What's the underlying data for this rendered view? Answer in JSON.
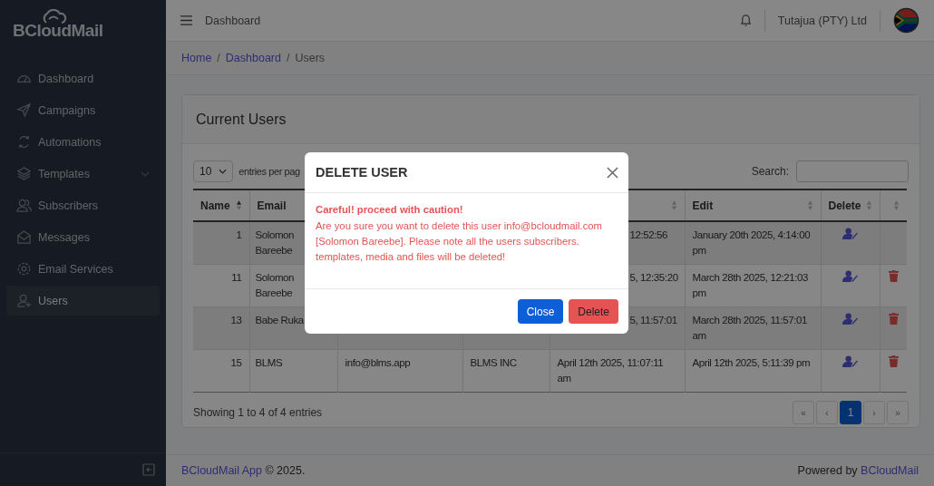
{
  "sidebar": {
    "logo": "BCloudMail",
    "items": [
      {
        "label": "Dashboard",
        "selected": false
      },
      {
        "label": "Campaigns",
        "selected": false
      },
      {
        "label": "Automations",
        "selected": false
      },
      {
        "label": "Templates",
        "selected": false,
        "expanded": false
      },
      {
        "label": "Subscribers",
        "selected": false
      },
      {
        "label": "Messages",
        "selected": false
      },
      {
        "label": "Email Services",
        "selected": false
      },
      {
        "label": "Users",
        "selected": true
      }
    ]
  },
  "header": {
    "title": "Dashboard",
    "company": "Tutajua (PTY) Ltd"
  },
  "breadcrumb": {
    "separator": "/",
    "items": [
      {
        "label": "Home",
        "current": false
      },
      {
        "label": "Dashboard",
        "current": false
      },
      {
        "label": "Users",
        "current": true
      }
    ]
  },
  "card": {
    "title": "Current Users",
    "entries": {
      "value": "10",
      "label": "entries per pag"
    },
    "search": {
      "label": "Search:"
    },
    "table": {
      "columns": [
        {
          "label": "Name",
          "sorted": true
        },
        {
          "label": "Email"
        },
        null,
        null,
        {
          "sorted": false
        },
        {
          "label": "Edit",
          "sorted": false
        },
        {
          "label": "Delete",
          "sorted": false
        },
        {
          "sorted": false
        }
      ],
      "rows": [
        {
          "cells": [
            {
              "text": "1",
              "kind": "full"
            },
            {
              "text": "Solomon Bareebe",
              "kind": "full"
            },
            null,
            null,
            {
              "text": "12:52:56",
              "kind": "partial"
            },
            {
              "text": "January 20th 2025, 4:14:00 pm",
              "kind": "full"
            }
          ],
          "deletable": false
        },
        {
          "cells": [
            {
              "text": "11",
              "kind": "full"
            },
            {
              "text": "Solomon Bareebe",
              "kind": "full"
            },
            null,
            null,
            {
              "text": "5, 12:35:20",
              "kind": "partial"
            },
            {
              "text": "March 28th 2025, 12:21:03 pm",
              "kind": "full"
            }
          ],
          "deletable": true
        },
        {
          "cells": [
            {
              "text": "13",
              "kind": "full"
            },
            {
              "text": "Babe Ruka",
              "kind": "full"
            },
            null,
            null,
            {
              "text": "5, 11:57:01",
              "kind": "partial"
            },
            {
              "text": "March 28th 2025, 11:57:01 am",
              "kind": "full"
            }
          ],
          "deletable": true
        },
        {
          "cells": [
            {
              "text": "15",
              "kind": "full"
            },
            {
              "text": "BLMS",
              "kind": "full"
            },
            {
              "text": "info@blms.app",
              "kind": "full"
            },
            {
              "text": "BLMS INC",
              "kind": "full"
            },
            {
              "text": "April 12th 2025, 11:07:11 am",
              "kind": "full"
            },
            {
              "text": "April 12th 2025, 5:11:39 pm",
              "kind": "full"
            }
          ],
          "deletable": true
        }
      ]
    },
    "info": "Showing 1 to 4 of 4 entries",
    "pagination": [
      {
        "label": "«",
        "selected": false
      },
      {
        "label": "‹",
        "selected": false
      },
      {
        "label": "1",
        "selected": true
      },
      {
        "label": "›",
        "selected": false
      },
      {
        "label": "»",
        "selected": false
      }
    ]
  },
  "footer": {
    "app_link": "BCloudMail App",
    "copyright": "© 2025.",
    "powered_by": "Powered by",
    "powered_link": "BCloudMail"
  },
  "modal": {
    "title": "DELETE USER",
    "warning": "Careful! proceed with caution!",
    "message": "Are you sure you want to delete this user info@bcloudmail.com [Solomon Bareebe]. Please note all the users subscribers. templates, media and files will be deleted!",
    "buttons": [
      {
        "label": "Close",
        "kind": "primary"
      },
      {
        "label": "Delete",
        "kind": "danger"
      }
    ]
  }
}
